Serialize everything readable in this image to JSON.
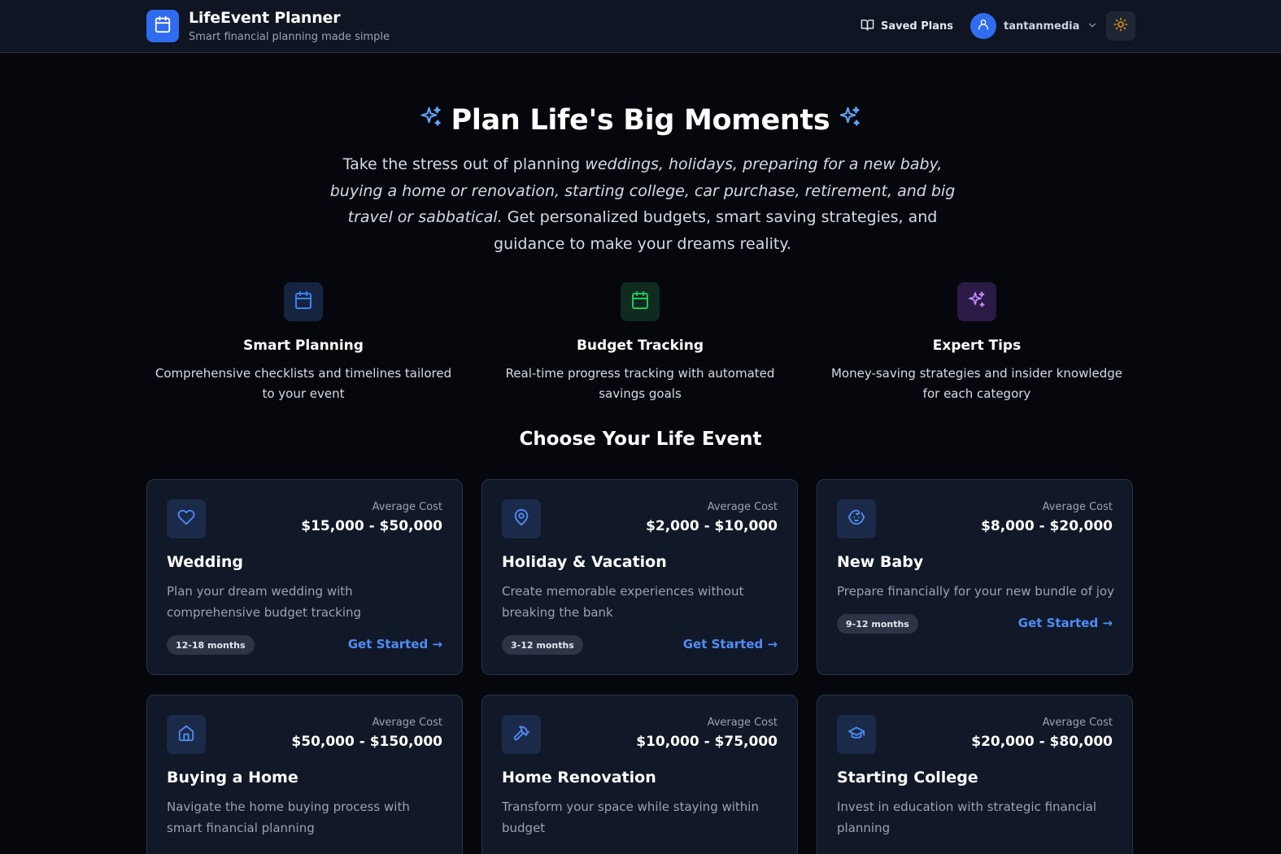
{
  "header": {
    "app_title": "LifeEvent Planner",
    "app_subtitle": "Smart financial planning made simple",
    "saved_plans_label": "Saved Plans",
    "username": "tantanmedia",
    "icons": {
      "logo": "calendar-icon",
      "saved_plans": "book-open-icon",
      "avatar": "user-icon",
      "user_menu": "chevron-down-icon",
      "theme_toggle": "sun-icon"
    }
  },
  "hero": {
    "title": "Plan Life's Big Moments",
    "desc_part1": "Take the stress out of planning ",
    "desc_italic": "weddings, holidays, preparing for a new baby, buying a home or renovation, starting college, car purchase, retirement, and big travel or sabbatical.",
    "desc_part2": " Get personalized budgets, smart saving strategies, and guidance to make your dreams reality.",
    "icon": "sparkles-icon"
  },
  "features": [
    {
      "title": "Smart Planning",
      "desc": "Comprehensive checklists and timelines tailored to your event",
      "icon": "calendar-icon",
      "color": "#3b82f6",
      "bg": "#16243f"
    },
    {
      "title": "Budget Tracking",
      "desc": "Real-time progress tracking with automated savings goals",
      "icon": "calendar-icon",
      "color": "#22c55e",
      "bg": "#0f2a1e"
    },
    {
      "title": "Expert Tips",
      "desc": "Money-saving strategies and insider knowledge for each category",
      "icon": "sparkles-icon",
      "color": "#c084fc",
      "bg": "#2a1a45"
    }
  ],
  "section_title": "Choose Your Life Event",
  "cards": [
    {
      "title": "Wedding",
      "cost_label": "Average Cost",
      "cost": "$15,000 - $50,000",
      "desc": "Plan your dream wedding with comprehensive budget tracking",
      "duration": "12-18 months",
      "cta": "Get Started →",
      "icon": "heart-icon"
    },
    {
      "title": "Holiday & Vacation",
      "cost_label": "Average Cost",
      "cost": "$2,000 - $10,000",
      "desc": "Create memorable experiences without breaking the bank",
      "duration": "3-12 months",
      "cta": "Get Started →",
      "icon": "map-pin-icon"
    },
    {
      "title": "New Baby",
      "cost_label": "Average Cost",
      "cost": "$8,000 - $20,000",
      "desc": "Prepare financially for your new bundle of joy",
      "duration": "9-12 months",
      "cta": "Get Started →",
      "icon": "baby-icon"
    },
    {
      "title": "Buying a Home",
      "cost_label": "Average Cost",
      "cost": "$50,000 - $150,000",
      "desc": "Navigate the home buying process with smart financial planning",
      "icon": "home-icon"
    },
    {
      "title": "Home Renovation",
      "cost_label": "Average Cost",
      "cost": "$10,000 - $75,000",
      "desc": "Transform your space while staying within budget",
      "icon": "hammer-icon"
    },
    {
      "title": "Starting College",
      "cost_label": "Average Cost",
      "cost": "$20,000 - $80,000",
      "desc": "Invest in education with strategic financial planning",
      "icon": "graduation-cap-icon"
    }
  ],
  "colors": {
    "accent": "#2f6cf0",
    "link": "#4f8df7",
    "card_icon": "#4f8df7",
    "theme_icon": "#f59e0b",
    "background": "#05070d",
    "card_bg": "#111827"
  }
}
